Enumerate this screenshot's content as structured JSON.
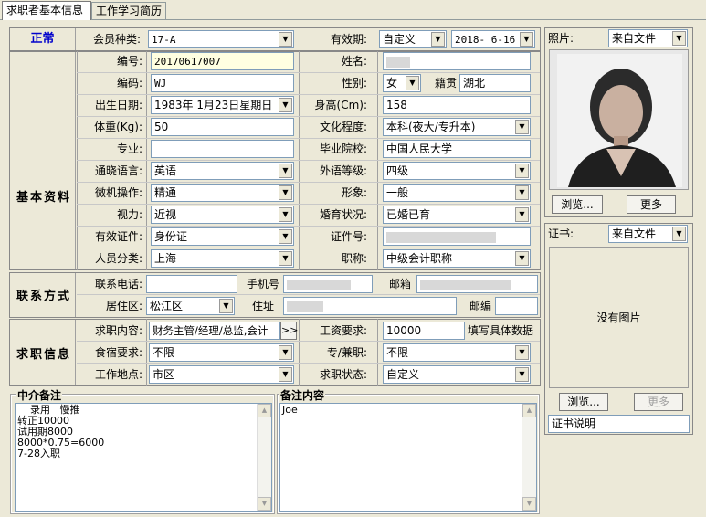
{
  "tabs": [
    {
      "label": "求职者基本信息",
      "active": true
    },
    {
      "label": "工作学习简历",
      "active": false
    }
  ],
  "status": {
    "label": "正常",
    "color": "#0000cc"
  },
  "section_titles": {
    "basic": "基本资料",
    "contact": "联系方式",
    "job": "求职信息"
  },
  "fields": {
    "member_type_label": "会员种类:",
    "member_type_value": "17-A",
    "validity_label": "有效期:",
    "validity_type": "自定义",
    "validity_date": "2018- 6-16",
    "number_label": "编号:",
    "number_value": "20170617007",
    "name_label": "姓名:",
    "code_label": "编码:",
    "code_value": "WJ",
    "gender_label": "性别:",
    "gender_value": "女",
    "native_label": "籍贯",
    "native_value": "湖北",
    "birth_label": "出生日期:",
    "birth_value": "1983年 1月23日星期日",
    "height_label": "身高(Cm):",
    "height_value": "158",
    "weight_label": "体重(Kg):",
    "weight_value": "50",
    "education_label": "文化程度:",
    "education_value": "本科(夜大/专升本)",
    "major_label": "专业:",
    "major_value": "",
    "school_label": "毕业院校:",
    "school_value": "中国人民大学",
    "language_label": "通晓语言:",
    "language_value": "英语",
    "foreign_level_label": "外语等级:",
    "foreign_level_value": "四级",
    "computer_label": "微机操作:",
    "computer_value": "精通",
    "image_label": "形象:",
    "image_value": "一般",
    "vision_label": "视力:",
    "vision_value": "近视",
    "marital_label": "婚育状况:",
    "marital_value": "已婚已育",
    "id_type_label": "有效证件:",
    "id_type_value": "身份证",
    "id_no_label": "证件号:",
    "category_label": "人员分类:",
    "category_value": "上海",
    "title_label": "职称:",
    "title_value": "中级会计职称",
    "phone_label": "联系电话:",
    "phone_value": "",
    "mobile_label": "手机号",
    "email_label": "邮箱",
    "district_label": "居住区:",
    "district_value": "松江区",
    "address_label": "住址",
    "postcode_label": "邮编",
    "postcode_value": "",
    "job_content_label": "求职内容:",
    "job_content_value": "财务主管/经理/总监,会计",
    "job_content_btn": ">>",
    "salary_label": "工资要求:",
    "salary_value": "10000",
    "salary_hint": "填写具体数据",
    "board_label": "食宿要求:",
    "board_value": "不限",
    "parttime_label": "专/兼职:",
    "parttime_value": "不限",
    "workplace_label": "工作地点:",
    "workplace_value": "市区",
    "job_status_label": "求职状态:",
    "job_status_value": "自定义"
  },
  "agency_note": {
    "title": "中介备注",
    "text": "    录用   慢推\n转正10000\n试用期8000\n8000*0.75=6000\n7-28入职"
  },
  "remark": {
    "title": "备注内容",
    "text": "Joe"
  },
  "photo": {
    "label": "照片:",
    "source": "来自文件",
    "browse": "浏览...",
    "more": "更多"
  },
  "certificate": {
    "label": "证书:",
    "source": "来自文件",
    "empty": "没有图片",
    "browse": "浏览...",
    "more": "更多",
    "caption": "证书说明"
  }
}
